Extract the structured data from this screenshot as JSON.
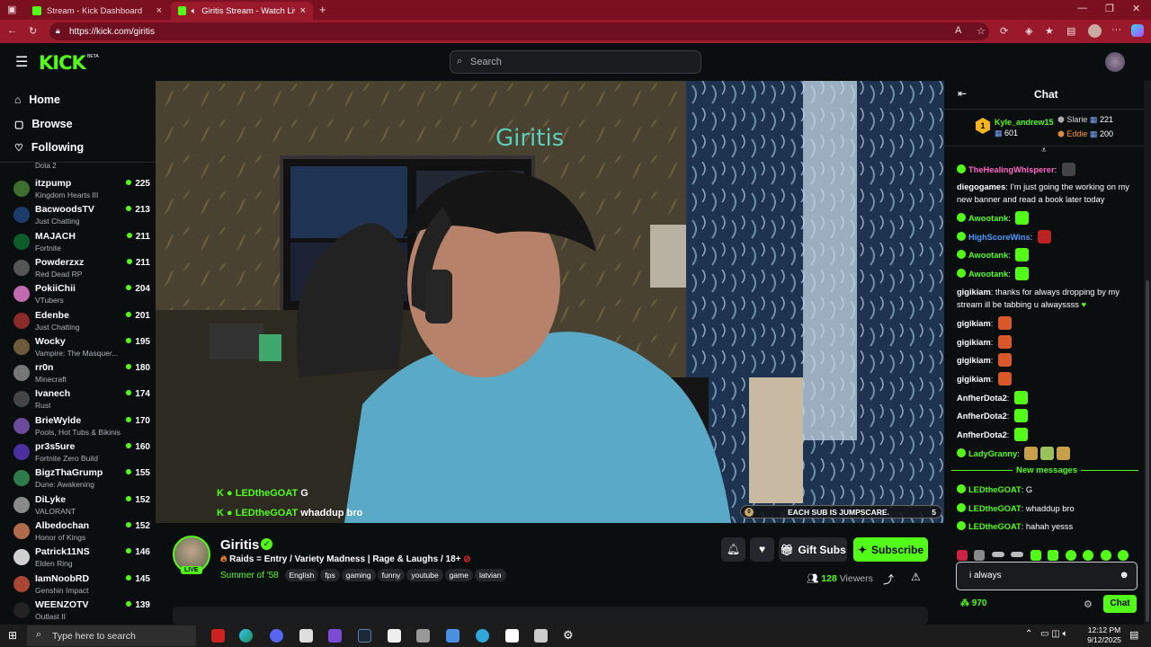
{
  "browser": {
    "tabs": [
      {
        "title": "Stream - Kick Dashboard"
      },
      {
        "title": "Giritis Stream - Watch Live o"
      }
    ],
    "url": "https://kick.com/giritis"
  },
  "header": {
    "logo": "KICK",
    "logo_beta": "BETA",
    "search_placeholder": "Search"
  },
  "sidebar": {
    "nav": [
      {
        "label": "Home"
      },
      {
        "label": "Browse"
      },
      {
        "label": "Following"
      }
    ],
    "partial_top_category": "Dota 2",
    "channels": [
      {
        "name": "itzpump",
        "category": "Kingdom Hearts III",
        "viewers": "225"
      },
      {
        "name": "BacwoodsTV",
        "category": "Just Chatting",
        "viewers": "213"
      },
      {
        "name": "MAJACH",
        "category": "Fortnite",
        "viewers": "211"
      },
      {
        "name": "Powderzxz",
        "category": "Red Dead RP",
        "viewers": "211"
      },
      {
        "name": "PokiiChii",
        "category": "VTubers",
        "viewers": "204"
      },
      {
        "name": "Edenbe",
        "category": "Just Chatting",
        "viewers": "201"
      },
      {
        "name": "Wocky",
        "category": "Vampire: The Masquer...",
        "viewers": "195"
      },
      {
        "name": "rr0n",
        "category": "Minecraft",
        "viewers": "180"
      },
      {
        "name": "Ivanech",
        "category": "Rust",
        "viewers": "174"
      },
      {
        "name": "BrieWylde",
        "category": "Pools, Hot Tubs & Bikinis",
        "viewers": "170"
      },
      {
        "name": "pr3s5ure",
        "category": "Fortnite Zero Build",
        "viewers": "160"
      },
      {
        "name": "BigzThaGrump",
        "category": "Dune: Awakening",
        "viewers": "155"
      },
      {
        "name": "DiLyke",
        "category": "VALORANT",
        "viewers": "152"
      },
      {
        "name": "Albedochan",
        "category": "Honor of Kings",
        "viewers": "152"
      },
      {
        "name": "Patrick11NS",
        "category": "Elden Ring",
        "viewers": "146"
      },
      {
        "name": "IamNoobRD",
        "category": "Genshin Impact",
        "viewers": "145"
      },
      {
        "name": "WEENZOTV",
        "category": "Outlast II",
        "viewers": "139"
      }
    ]
  },
  "video": {
    "overlay_chat": [
      {
        "user": "LEDtheGOAT",
        "text": "G"
      },
      {
        "user": "LEDtheGOAT",
        "text": "whaddup bro"
      }
    ],
    "sub_goal": {
      "current": "0",
      "label": "EACH SUB IS JUMPSCARE.",
      "target": "5"
    }
  },
  "channel": {
    "name": "Giritis",
    "live_badge": "LIVE",
    "title": "Raids = Entry / Variety Madness | Rage & Laughs / 18+",
    "category": "Summer of '58",
    "tags": [
      "English",
      "fps",
      "gaming",
      "funny",
      "youtube",
      "game",
      "latvian"
    ],
    "gift_subs_label": "Gift Subs",
    "subscribe_label": "Subscribe",
    "viewers": "128",
    "viewers_label": "Viewers"
  },
  "chat": {
    "title": "Chat",
    "leaderboard": [
      {
        "rank": "1",
        "name": "Kyle_andrew15",
        "count": "601"
      },
      {
        "name": "Slarie",
        "count": "221"
      },
      {
        "name": "Eddie",
        "count": "200"
      }
    ],
    "messages": [
      {
        "user": "TheHealingWhisperer",
        "text": "",
        "color": "#ff66c4"
      },
      {
        "user": "diegogames",
        "text": "I'm just going the working on my new banner and read a book later today",
        "color": "#ffffff"
      },
      {
        "user": "Awootank",
        "text": "",
        "color": "#53fc18"
      },
      {
        "user": "HighScoreWins",
        "text": "",
        "color": "#4d9bff"
      },
      {
        "user": "Awootank",
        "text": "",
        "color": "#53fc18"
      },
      {
        "user": "Awootank",
        "text": "",
        "color": "#53fc18"
      },
      {
        "user": "gigikiam",
        "text": "thanks for always dropping by my stream ill be tabbing u alwayssss",
        "color": "#ffffff"
      },
      {
        "user": "gigikiam",
        "text": "",
        "color": "#ffffff"
      },
      {
        "user": "gigikiam",
        "text": "",
        "color": "#ffffff"
      },
      {
        "user": "gigikiam",
        "text": "",
        "color": "#ffffff"
      },
      {
        "user": "gigikiam",
        "text": "",
        "color": "#ffffff"
      },
      {
        "user": "AnfherDota2",
        "text": "",
        "color": "#ffffff"
      },
      {
        "user": "AnfherDota2",
        "text": "",
        "color": "#ffffff"
      },
      {
        "user": "AnfherDota2",
        "text": "",
        "color": "#ffffff"
      },
      {
        "user": "LadyGranny",
        "text": "",
        "color": "#53fc18"
      }
    ],
    "new_messages_label": "New messages",
    "new_messages": [
      {
        "user": "LEDtheGOAT",
        "text": "G"
      },
      {
        "user": "LEDtheGOAT",
        "text": "whaddup bro"
      },
      {
        "user": "LEDtheGOAT",
        "text": "hahah yesss"
      }
    ],
    "input_value": "i always",
    "points": "970",
    "send_label": "Chat"
  },
  "taskbar": {
    "search_placeholder": "Type here to search",
    "time": "12:12 PM",
    "date": "9/12/2025"
  },
  "colors": {
    "kick_green": "#53fc18",
    "browser_red": "#9a1a2c",
    "bg": "#0b0e0f"
  }
}
